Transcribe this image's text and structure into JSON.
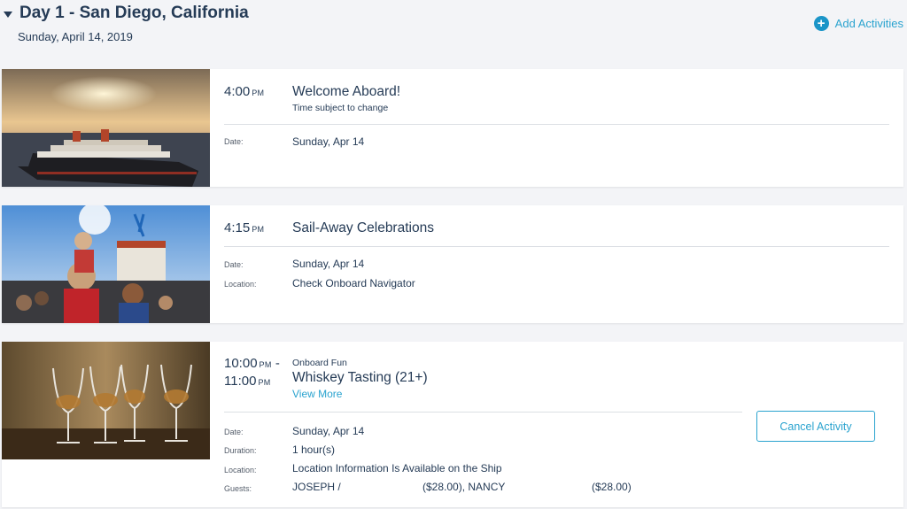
{
  "day": {
    "title": "Day 1 - San Diego, California",
    "date": "Sunday, April 14, 2019",
    "add_activities_label": "Add Activities"
  },
  "activities": [
    {
      "time": "4:00",
      "ampm": "PM",
      "title": "Welcome Aboard!",
      "subtitle": "Time subject to change",
      "details": [
        {
          "label": "Date:",
          "value": "Sunday, Apr 14"
        }
      ]
    },
    {
      "time": "4:15",
      "ampm": "PM",
      "title": "Sail-Away Celebrations",
      "details": [
        {
          "label": "Date:",
          "value": "Sunday, Apr 14"
        },
        {
          "label": "Location:",
          "value": "Check Onboard Navigator"
        }
      ]
    },
    {
      "time_start": "10:00",
      "ampm_start": "PM",
      "time_end": "11:00",
      "ampm_end": "PM",
      "category": "Onboard Fun",
      "title": "Whiskey Tasting (21+)",
      "view_more": "View More",
      "cancel_label": "Cancel Activity",
      "details": [
        {
          "label": "Date:",
          "value": "Sunday, Apr 14"
        },
        {
          "label": "Duration:",
          "value": "1 hour(s)"
        },
        {
          "label": "Location:",
          "value": "Location Information Is Available on the Ship"
        },
        {
          "label": "Guests:",
          "value": "JOSEPH /"
        }
      ],
      "guest_amount_1": "($28.00), NANCY",
      "guest_amount_2": "($28.00)"
    }
  ],
  "colors": {
    "accent": "#2aa3cf",
    "text": "#253b56",
    "background": "#f3f4f7"
  }
}
